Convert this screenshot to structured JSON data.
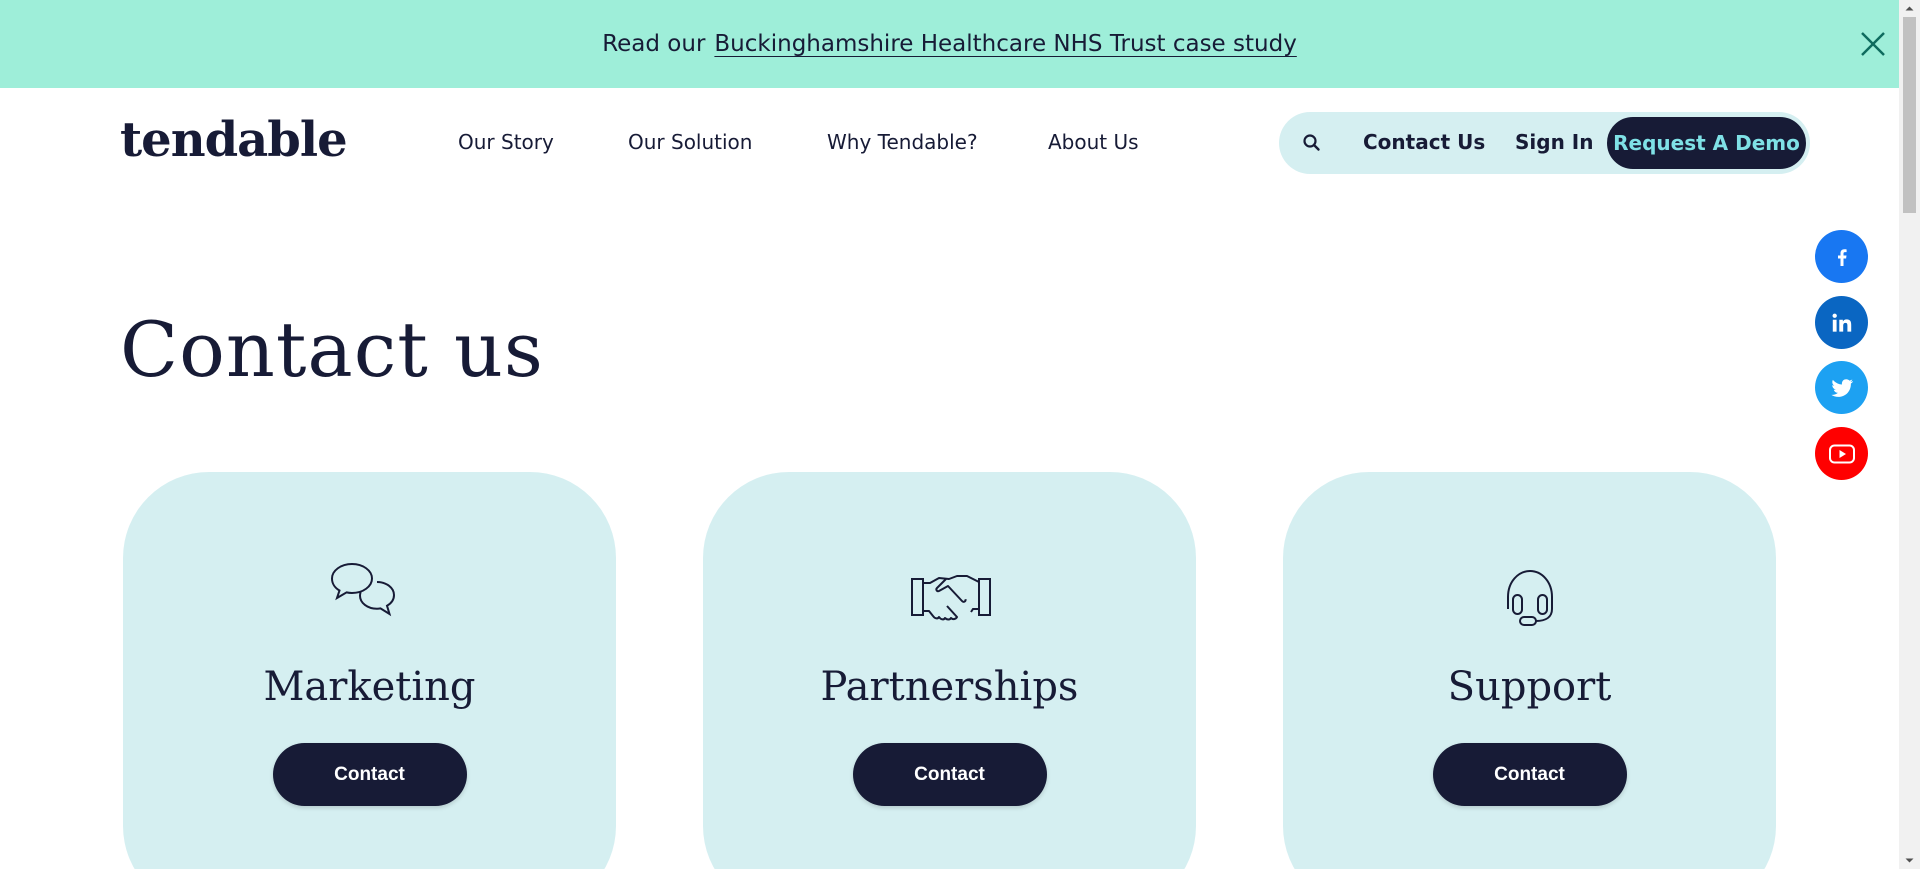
{
  "banner": {
    "lead_text": "Read our",
    "link_text": "Buckinghamshire Healthcare NHS Trust case study",
    "close_icon": "close-icon",
    "background_color": "#9eeed9"
  },
  "header": {
    "logo_text": "tendable",
    "nav": [
      "Our Story",
      "Our Solution",
      "Why Tendable?",
      "About Us"
    ],
    "search_icon": "search-icon",
    "contact_label": "Contact Us",
    "signin_label": "Sign In",
    "demo_label": "Request A Demo"
  },
  "social": [
    {
      "name": "facebook-icon",
      "color": "#1877f2"
    },
    {
      "name": "linkedin-icon",
      "color": "#0a66c2"
    },
    {
      "name": "twitter-icon",
      "color": "#1da1f2"
    },
    {
      "name": "youtube-icon",
      "color": "#ff0000"
    }
  ],
  "main": {
    "title": "Contact us",
    "cards": [
      {
        "title": "Marketing",
        "button": "Contact",
        "icon": "chat-bubbles-icon"
      },
      {
        "title": "Partnerships",
        "button": "Contact",
        "icon": "handshake-icon"
      },
      {
        "title": "Support",
        "button": "Contact",
        "icon": "headset-icon"
      }
    ]
  },
  "colors": {
    "navy": "#171b36",
    "card_background": "#d5eff1",
    "demo_text": "#7fe1e6"
  }
}
